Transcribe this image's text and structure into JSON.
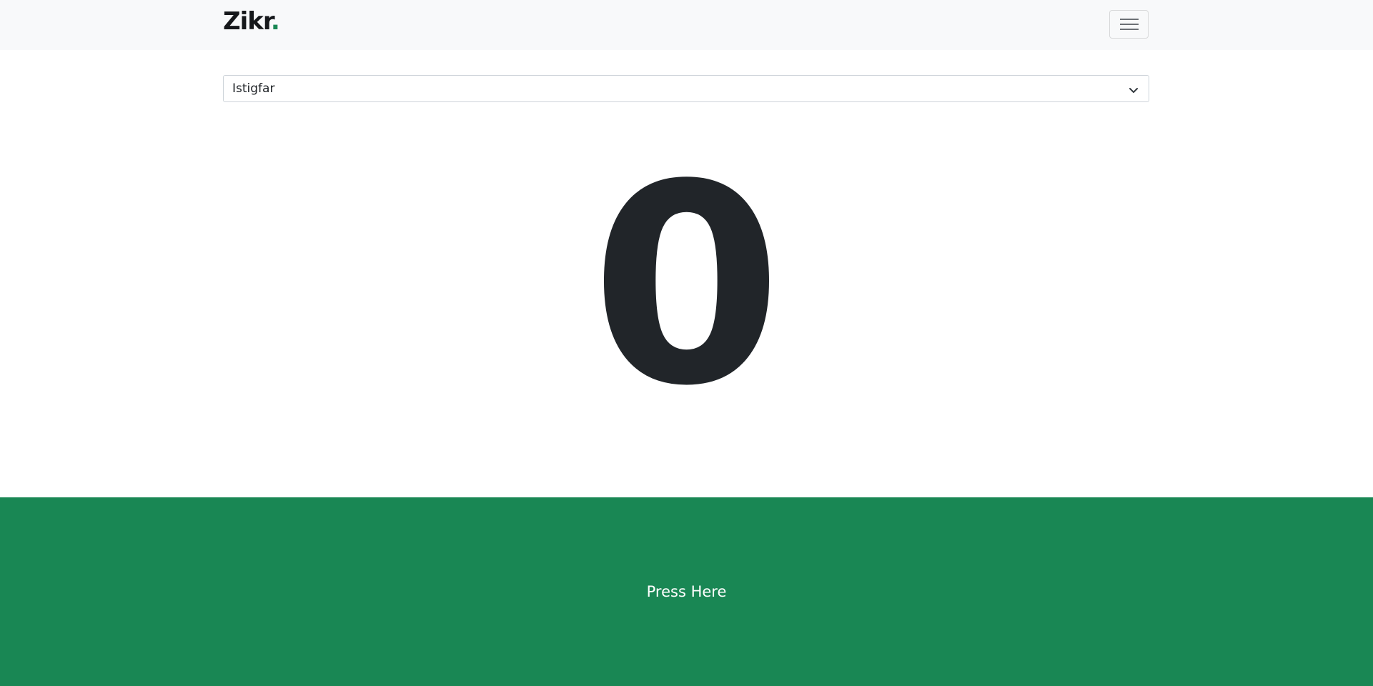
{
  "navbar": {
    "brand": "Zikr",
    "brand_dot": ".",
    "menu_icon": "hamburger-menu-icon"
  },
  "zikr_select": {
    "selected": "Istigfar",
    "chevron_icon": "chevron-down-icon"
  },
  "counter": {
    "value": "0"
  },
  "press_button": {
    "label": "Press Here"
  },
  "colors": {
    "accent": "#198754",
    "navbar_bg": "#f8f9fa",
    "text": "#212529",
    "button_text": "#ffffff"
  }
}
